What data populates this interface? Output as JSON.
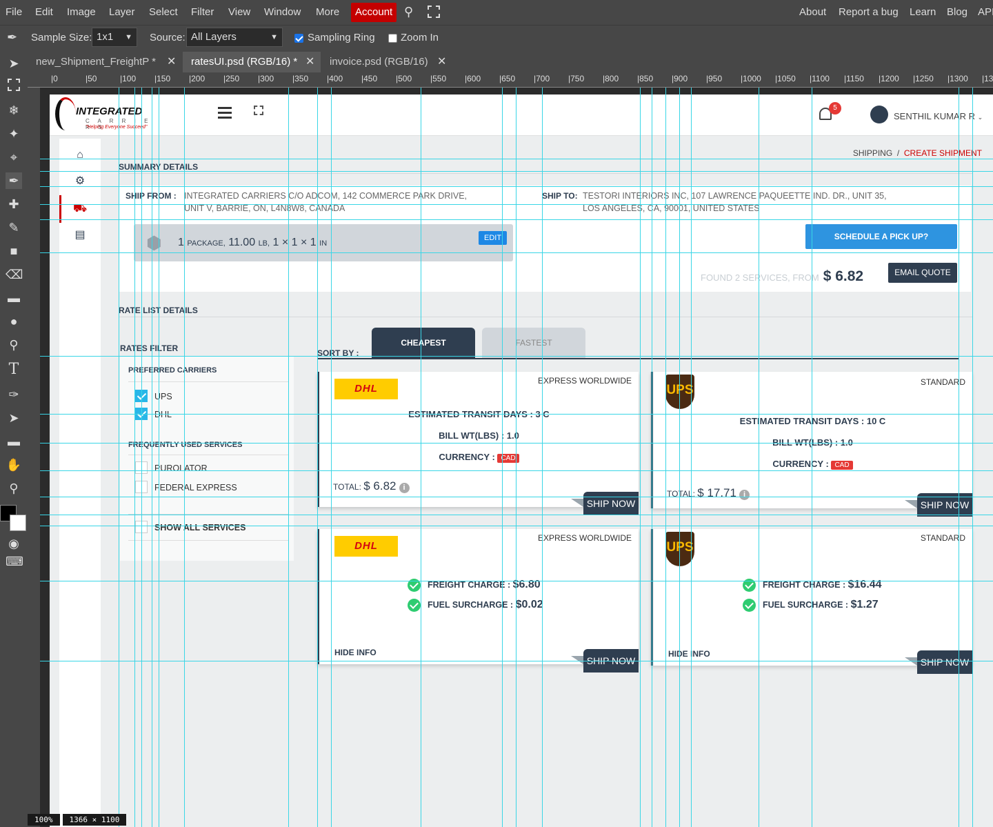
{
  "menu": {
    "items": [
      "File",
      "Edit",
      "Image",
      "Layer",
      "Select",
      "Filter",
      "View",
      "Window",
      "More"
    ],
    "account": "Account",
    "right_items": [
      "About",
      "Report a bug",
      "Learn",
      "Blog",
      "API"
    ]
  },
  "options": {
    "sample_size_label": "Sample Size:",
    "sample_size_value": "1x1",
    "source_label": "Source:",
    "source_value": "All Layers",
    "sampling_ring": "Sampling Ring",
    "zoom_in": "Zoom In"
  },
  "tabs": [
    {
      "label": "new_Shipment_FreightP *"
    },
    {
      "label": "ratesUI.psd (RGB/16) *"
    },
    {
      "label": "invoice.psd (RGB/16)"
    }
  ],
  "ruler_ticks": [
    "0",
    "50",
    "100",
    "150",
    "200",
    "250",
    "300",
    "350",
    "400",
    "450",
    "500",
    "550",
    "600",
    "650",
    "700",
    "750",
    "800",
    "850",
    "900",
    "950",
    "1000",
    "1050",
    "1100",
    "1150",
    "1200",
    "1250",
    "1300",
    "13"
  ],
  "status": {
    "zoom": "100%",
    "size": "1366 × 1100"
  },
  "app": {
    "logo_main": "INTEGRATED",
    "logo_sub": "C A R R I E R S",
    "logo_tag": "\"Helping Everyone Succeed\"",
    "notif_count": "5",
    "user": "SENTHIL KUMAR R",
    "breadcrumb_root": "SHIPPING",
    "breadcrumb_sep": "/",
    "breadcrumb_current": "CREATE SHIPMENT"
  },
  "summary": {
    "title": "SUMMARY DETAILS",
    "ship_from_label": "SHIP FROM :",
    "ship_from_line1": "INTEGRATED CARRIERS C/O ADCOM, 142 COMMERCE PARK DRIVE,",
    "ship_from_line2": "UNIT V, BARRIE, ON, L4N8W8, CANADA",
    "ship_to_label": "SHIP TO:",
    "ship_to_line1": "TESTORI INTERIORS INC, 107 LAWRENCE PAQUEETTE IND. DR., UNIT 35,",
    "ship_to_line2": "LOS ANGELES, CA, 90001, UNITED STATES",
    "pkg_count": "1",
    "pkg_unit": "PACKAGE,",
    "pkg_weight": "11.00",
    "pkg_weight_unit": "LB,",
    "pkg_dims": "1 × 1 × 1",
    "pkg_dim_unit": "IN",
    "edit": "EDIT",
    "schedule": "SCHEDULE A PICK UP?",
    "found": "FOUND 2 SERVICES, FROM",
    "found_price": "$ 6.82",
    "email_quote": "EMAIL QUOTE"
  },
  "rates": {
    "title": "RATE LIST DETAILS",
    "filter_title": "RATES FILTER",
    "preferred": "PREFERRED CARRIERS",
    "carriers": [
      "UPS",
      "DHL"
    ],
    "frequent": "FREQUENTLY USED SERVICES",
    "frequent_items": [
      "PUROLATOR",
      "FEDERAL EXPRESS"
    ],
    "show_all": "SHOW ALL SERVICES",
    "sort_by": "SORT BY :",
    "sort_cheapest": "CHEAPEST",
    "sort_fastest": "FASTEST"
  },
  "cards": [
    {
      "carrier": "DHL",
      "service": "EXPRESS WORLDWIDE",
      "transit": "ESTIMATED TRANSIT DAYS : 3 C",
      "billwt": "BILL WT(LBS) : 1.0",
      "currency_label": "CURRENCY :",
      "currency": "CAD",
      "total_label": "TOTAL:",
      "total": "$ 6.82",
      "ship": "SHIP NOW"
    },
    {
      "carrier": "UPS",
      "service": "STANDARD",
      "transit": "ESTIMATED TRANSIT DAYS : 10 C",
      "billwt": "BILL WT(LBS) : 1.0",
      "currency_label": "CURRENCY :",
      "currency": "CAD",
      "total_label": "TOTAL:",
      "total": "$ 17.71",
      "ship": "SHIP NOW"
    },
    {
      "carrier": "DHL",
      "service": "EXPRESS WORLDWIDE",
      "freight_label": "FREIGHT CHARGE :",
      "freight": "$6.80",
      "fuel_label": "FUEL SURCHARGE :",
      "fuel": "$0.02",
      "hide": "HIDE INFO",
      "ship": "SHIP NOW"
    },
    {
      "carrier": "UPS",
      "service": "STANDARD",
      "freight_label": "FREIGHT CHARGE :",
      "freight": "$16.44",
      "fuel_label": "FUEL SURCHARGE :",
      "fuel": "$1.27",
      "hide": "HIDE INFO",
      "ship": "SHIP NOW"
    }
  ],
  "colors": {
    "accent": "#c40000",
    "navy": "#2f3e50",
    "guide": "#39d6e6",
    "button_blue": "#2e94e0"
  }
}
